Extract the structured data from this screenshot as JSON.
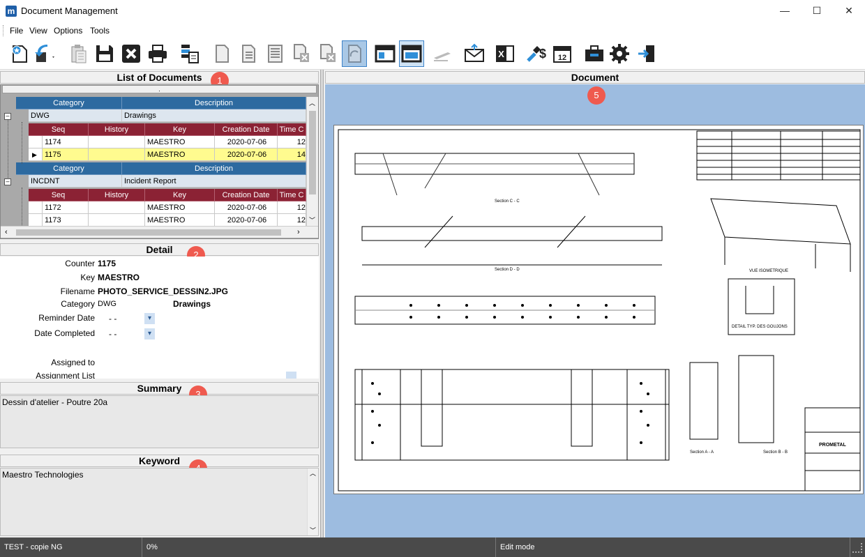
{
  "window": {
    "app_icon": "m",
    "title": "Document Management",
    "minimize": "—",
    "maximize": "☐",
    "close": "✕"
  },
  "menu": [
    "File",
    "View",
    "Options",
    "Tools"
  ],
  "toolbar": {
    "icons": [
      "new-document-icon",
      "undo-icon",
      "paste-icon",
      "save-icon",
      "delete-icon",
      "print-icon",
      "scan-icon",
      "blank-page-icon",
      "text-page-icon",
      "document-lines-icon",
      "copy-document-icon",
      "copy-document-x-icon",
      "rotate-icon",
      "window-icon",
      "window-active-icon",
      "pen-icon",
      "email-icon",
      "excel-icon",
      "pricing-icon",
      "calendar-icon",
      "toolbox-icon",
      "settings-icon",
      "exit-icon"
    ],
    "calendar_day": "12",
    "excel_letter": "X"
  },
  "list_panel": {
    "title": "List of Documents",
    "badge": "1",
    "group_bar": ".",
    "groups": [
      {
        "headers": {
          "category": "Category",
          "description": "Description"
        },
        "category": "DWG",
        "description": "Drawings",
        "columns": [
          "Seq",
          "History",
          "Key",
          "Creation Date",
          "Time C"
        ],
        "rows": [
          {
            "seq": "1174",
            "history": "",
            "key": "MAESTRO",
            "date": "2020-07-06",
            "time": "12"
          },
          {
            "seq": "1175",
            "history": "",
            "key": "MAESTRO",
            "date": "2020-07-06",
            "time": "14"
          }
        ]
      },
      {
        "headers": {
          "category": "Category",
          "description": "Description"
        },
        "category": "INCDNT",
        "description": "Incident Report",
        "columns": [
          "Seq",
          "History",
          "Key",
          "Creation Date",
          "Time C"
        ],
        "rows": [
          {
            "seq": "1172",
            "history": "",
            "key": "MAESTRO",
            "date": "2020-07-06",
            "time": "12"
          },
          {
            "seq": "1173",
            "history": "",
            "key": "MAESTRO",
            "date": "2020-07-06",
            "time": "12"
          }
        ]
      }
    ]
  },
  "detail": {
    "title": "Detail",
    "badge": "2",
    "counter_label": "Counter",
    "counter": "1175",
    "key_label": "Key",
    "key": "MAESTRO",
    "filename_label": "Filename",
    "filename": "PHOTO_SERVICE_DESSIN2.JPG",
    "category_label": "Category",
    "category": "DWG",
    "category_desc": "Drawings",
    "reminder_label": "Reminder Date",
    "reminder_value": "- -",
    "completed_label": "Date Completed",
    "completed_value": "- -",
    "assigned_label": "Assigned to",
    "assignment_list_label": "Assignment List"
  },
  "summary": {
    "title": "Summary",
    "badge": "3",
    "text": "Dessin d'atelier - Poutre 20a"
  },
  "keyword": {
    "title": "Keyword",
    "badge": "4",
    "text": "Maestro Technologies"
  },
  "document": {
    "title": "Document",
    "badge": "5",
    "drawing_labels": [
      "Section C - C",
      "Section D - D",
      "Section A - A",
      "Section B - B",
      "VUE ISOMETRIQUE",
      "DETAIL TYP. DES GOUJONS"
    ],
    "title_block": "PROMETAL"
  },
  "status": {
    "profile": "TEST - copie NG",
    "progress": "0%",
    "mode": "Edit mode"
  },
  "colors": {
    "accent": "#ef5a4f",
    "group_header": "#2d6aa0",
    "column_header": "#8b2234",
    "selected_row": "#fffb8f",
    "doc_background": "#9dbce0"
  }
}
